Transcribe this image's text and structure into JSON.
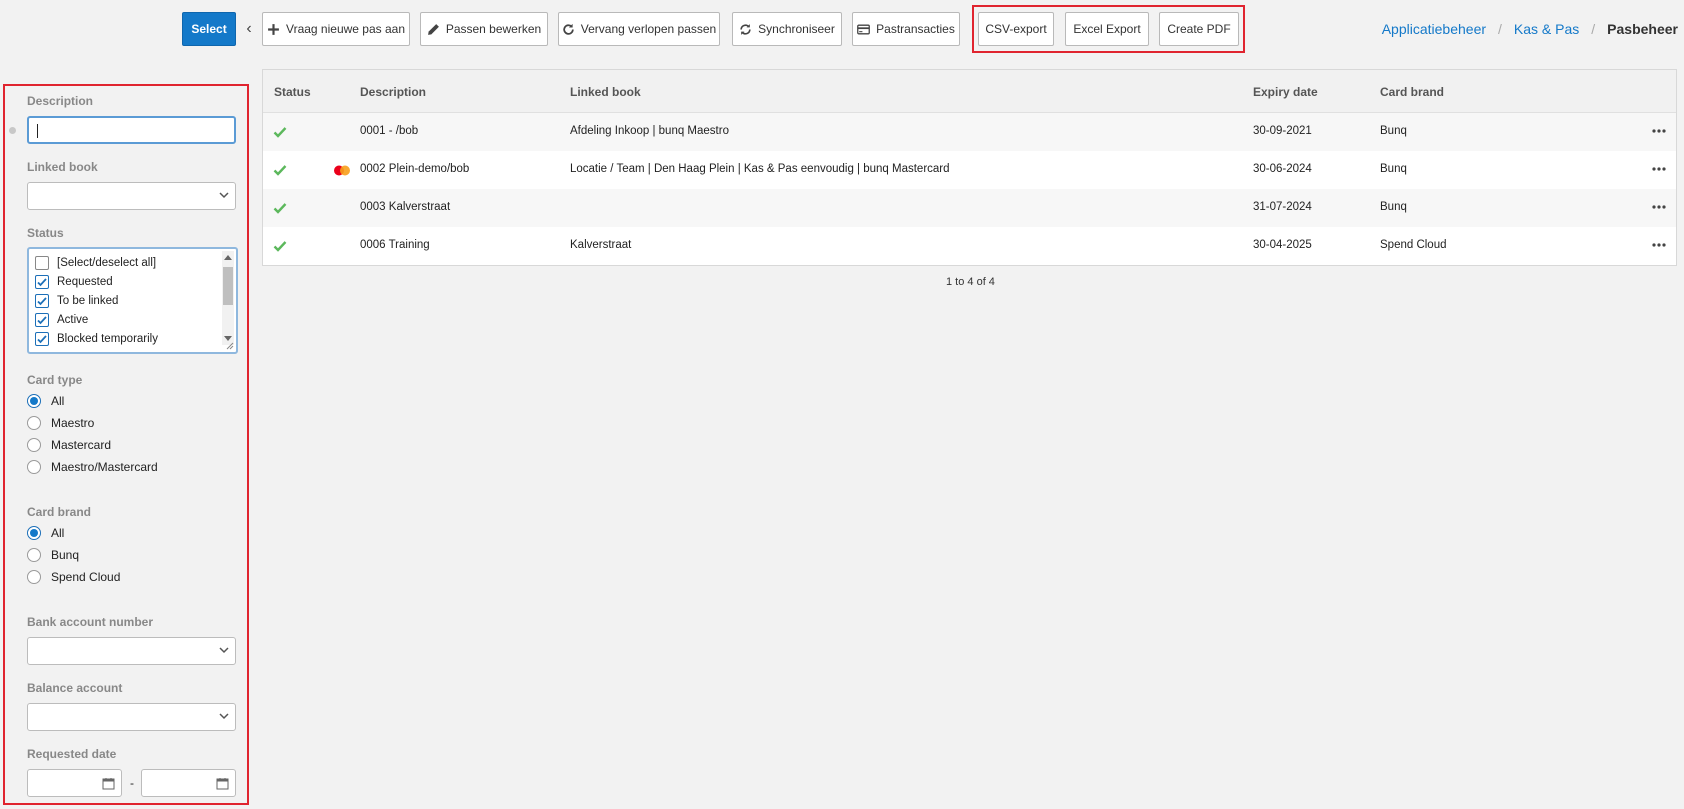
{
  "toolbar": {
    "select_label": "Select",
    "buttons": [
      {
        "label": "Vraag nieuwe pas aan",
        "icon": "plus-icon"
      },
      {
        "label": "Passen bewerken",
        "icon": "pencil-icon"
      },
      {
        "label": "Vervang verlopen passen",
        "icon": "refresh-icon"
      },
      {
        "label": "Synchroniseer",
        "icon": "sync-icon"
      },
      {
        "label": "Pastransacties",
        "icon": "credit-card-icon"
      }
    ],
    "export_buttons": [
      "CSV-export",
      "Excel Export",
      "Create PDF"
    ]
  },
  "breadcrumb": {
    "items": [
      "Applicatiebeheer",
      "Kas & Pas"
    ],
    "current": "Pasbeheer"
  },
  "filters": {
    "description_label": "Description",
    "description_value": "",
    "linked_book_label": "Linked book",
    "status_label": "Status",
    "status_options": [
      {
        "label": "[Select/deselect all]",
        "checked": false
      },
      {
        "label": "Requested",
        "checked": true
      },
      {
        "label": "To be linked",
        "checked": true
      },
      {
        "label": "Active",
        "checked": true
      },
      {
        "label": "Blocked temporarily",
        "checked": true
      }
    ],
    "card_type_label": "Card type",
    "card_type_options": [
      {
        "label": "All",
        "selected": true
      },
      {
        "label": "Maestro",
        "selected": false
      },
      {
        "label": "Mastercard",
        "selected": false
      },
      {
        "label": "Maestro/Mastercard",
        "selected": false
      }
    ],
    "card_brand_label": "Card brand",
    "card_brand_options": [
      {
        "label": "All",
        "selected": true
      },
      {
        "label": "Bunq",
        "selected": false
      },
      {
        "label": "Spend Cloud",
        "selected": false
      }
    ],
    "bank_account_label": "Bank account number",
    "balance_account_label": "Balance account",
    "requested_date_label": "Requested date",
    "date_separator": "-"
  },
  "table": {
    "columns": [
      "Status",
      "Description",
      "Linked book",
      "Expiry date",
      "Card brand"
    ],
    "rows": [
      {
        "status": "active",
        "mastercard": false,
        "description": "0001 - /bob",
        "linked_book": "Afdeling Inkoop | bunq Maestro",
        "expiry": "30-09-2021",
        "brand": "Bunq"
      },
      {
        "status": "active",
        "mastercard": true,
        "description": "0002 Plein-demo/bob",
        "linked_book": "Locatie / Team | Den Haag Plein | Kas & Pas eenvoudig | bunq Mastercard",
        "expiry": "30-06-2024",
        "brand": "Bunq"
      },
      {
        "status": "active",
        "mastercard": false,
        "description": "0003 Kalverstraat",
        "linked_book": "",
        "expiry": "31-07-2024",
        "brand": "Bunq"
      },
      {
        "status": "active",
        "mastercard": false,
        "description": "0006 Training",
        "linked_book": "Kalverstraat",
        "expiry": "30-04-2025",
        "brand": "Spend Cloud"
      }
    ],
    "pager": "1 to 4 of 4"
  },
  "colors": {
    "primary": "#1479c9",
    "check": "#5cb85c",
    "highlight": "#e0242f"
  }
}
